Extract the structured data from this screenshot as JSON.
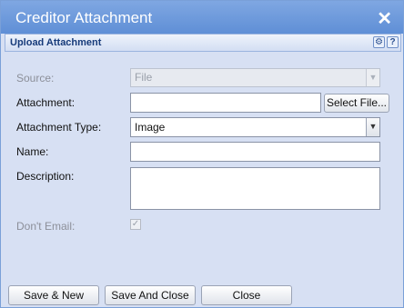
{
  "window": {
    "title": "Creditor Attachment",
    "close_icon": "close-icon"
  },
  "panel": {
    "title": "Upload Attachment",
    "icons": [
      "gear-icon",
      "help-icon"
    ],
    "help_glyph": "?"
  },
  "form": {
    "source": {
      "label": "Source:",
      "value": "File",
      "disabled": true
    },
    "attachment": {
      "label": "Attachment:",
      "value": "",
      "button": "Select File..."
    },
    "attachment_type": {
      "label": "Attachment Type:",
      "value": "Image"
    },
    "name": {
      "label": "Name:",
      "value": ""
    },
    "description": {
      "label": "Description:",
      "value": ""
    },
    "dont_email": {
      "label": "Don't Email:",
      "checked": true,
      "disabled": true
    }
  },
  "buttons": {
    "save_new": "Save & New",
    "save_close": "Save And Close",
    "close": "Close"
  },
  "colors": {
    "titlebar": "#6a97db",
    "body": "#d7e0f3",
    "panel_title": "#173b7a"
  }
}
